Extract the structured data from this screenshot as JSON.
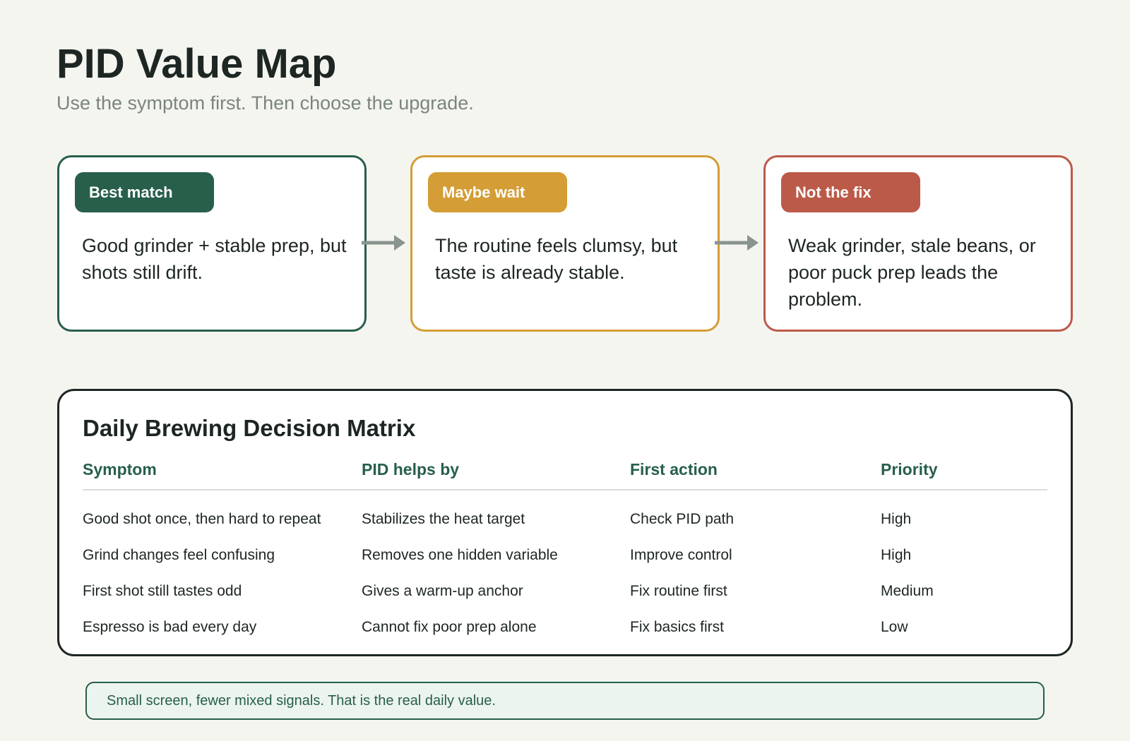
{
  "header": {
    "title": "PID Value Map",
    "subtitle": "Use the symptom first. Then choose the upgrade."
  },
  "cards": [
    {
      "badge": "Best match",
      "text": "Good grinder + stable prep, but shots still drift.",
      "color": "#275f4b"
    },
    {
      "badge": "Maybe wait",
      "text": "The routine feels clumsy, but taste is already stable.",
      "color": "#d49d35"
    },
    {
      "badge": "Not the fix",
      "text": "Weak grinder, stale beans, or poor puck prep leads the problem.",
      "color": "#bc5a49"
    }
  ],
  "matrix": {
    "title": "Daily Brewing Decision Matrix",
    "columns": [
      "Symptom",
      "PID helps by",
      "First action",
      "Priority"
    ],
    "rows": [
      [
        "Good shot once, then hard to repeat",
        "Stabilizes the heat target",
        "Check PID path",
        "High"
      ],
      [
        "Grind changes feel confusing",
        "Removes one hidden variable",
        "Improve control",
        "High"
      ],
      [
        "First shot still tastes odd",
        "Gives a warm-up anchor",
        "Fix routine first",
        "Medium"
      ],
      [
        "Espresso is bad every day",
        "Cannot fix poor prep alone",
        "Fix basics first",
        "Low"
      ]
    ]
  },
  "note": "Small screen, fewer mixed signals. That is the real daily value.",
  "colors": {
    "green": "#275f4b",
    "yellow": "#d49d35",
    "red": "#bc5a49",
    "arrow": "#8a948f"
  },
  "icons": [
    "arrow-right-icon",
    "arrow-right-icon"
  ]
}
